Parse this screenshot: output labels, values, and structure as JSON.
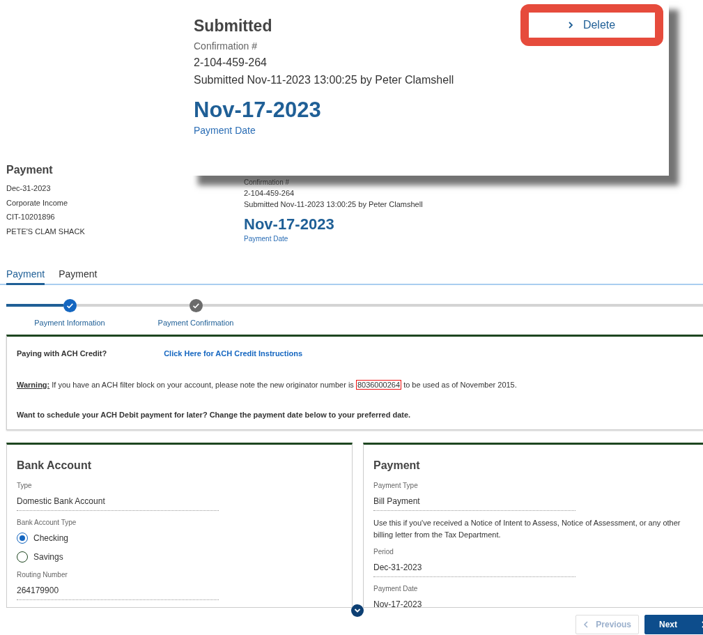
{
  "callout": {
    "status": "Submitted",
    "confirmation_label": "Confirmation #",
    "confirmation_number": "2-104-459-264",
    "submitted_text": "Submitted Nov-11-2023 13:00:25 by Peter Clamshell",
    "payment_date": "Nov-17-2023",
    "payment_date_label": "Payment Date",
    "delete_label": "Delete"
  },
  "summary": {
    "title": "Payment",
    "lines": [
      "Dec-31-2023",
      "Corporate Income",
      "CIT-10201896",
      "PETE'S CLAM SHACK"
    ]
  },
  "submission": {
    "confirmation_label": "Confirmation #",
    "confirmation_number": "2-104-459-264",
    "submitted_text": "Submitted Nov-11-2023 13:00:25 by Peter Clamshell",
    "payment_date": "Nov-17-2023",
    "payment_date_label": "Payment Date"
  },
  "tabs": [
    {
      "label": "Payment",
      "selected": true
    },
    {
      "label": "Payment",
      "selected": false
    }
  ],
  "steps": [
    {
      "label": "Payment Information",
      "selected": true
    },
    {
      "label": "Payment Confirmation",
      "selected": false
    }
  ],
  "notice": {
    "credit_label": "Paying with ACH Credit?",
    "credit_link": "Click Here for ACH Credit Instructions",
    "warning_label": "Warning:",
    "warning_text": "If you have an ACH filter block on your account, please note the new originator number is",
    "originator_number": "8036000264",
    "warning_end": "to be used as of November 2015.",
    "schedule_text": "Want to schedule your ACH Debit payment for later? Change the payment date below to your preferred date."
  },
  "bank_account": {
    "title": "Bank Account",
    "type_label": "Type",
    "type_value": "Domestic Bank Account",
    "account_type_label": "Bank Account Type",
    "options": [
      {
        "label": "Checking",
        "selected": true
      },
      {
        "label": "Savings",
        "selected": false
      }
    ],
    "routing_label": "Routing Number",
    "routing_value": "264179900"
  },
  "payment": {
    "title": "Payment",
    "type_label": "Payment Type",
    "type_value": "Bill Payment",
    "help_text": "Use this if you've received a Notice of Intent to Assess, Notice of Assessment, or any other billing letter from the Tax Department.",
    "period_label": "Period",
    "period_value": "Dec-31-2023",
    "date_label": "Payment Date",
    "date_value": "Nov-17-2023"
  },
  "nav_buttons": [
    {
      "label": "Previous",
      "disabled": true
    },
    {
      "label": "Next",
      "disabled": false
    }
  ]
}
